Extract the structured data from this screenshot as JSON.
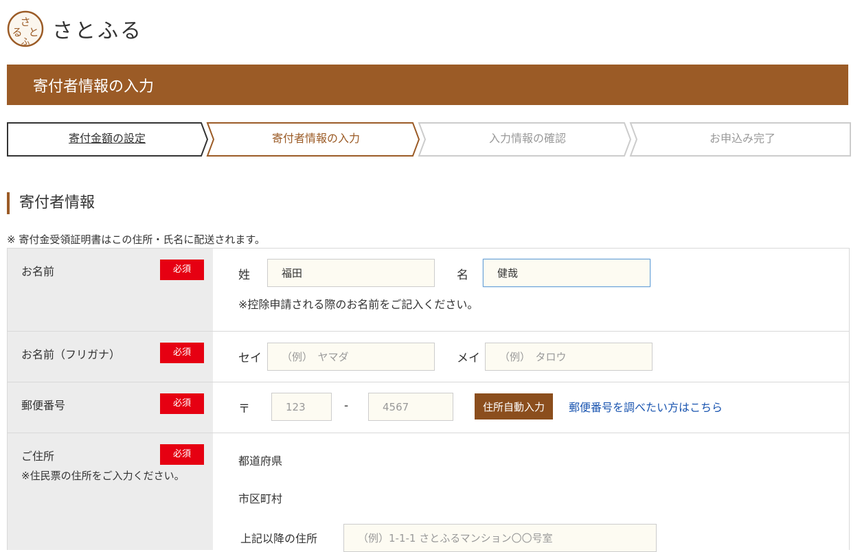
{
  "brand": {
    "name": "さとふる",
    "mark_text": "さとふる"
  },
  "page_title": "寄付者情報の入力",
  "steps": [
    {
      "label": "寄付金額の設定",
      "state": "done"
    },
    {
      "label": "寄付者情報の入力",
      "state": "current"
    },
    {
      "label": "入力情報の確認",
      "state": "upcoming"
    },
    {
      "label": "お申込み完了",
      "state": "upcoming"
    }
  ],
  "section_title": "寄付者情報",
  "note": "※ 寄付金受領証明書はこの住所・氏名に配送されます。",
  "required_label": "必須",
  "form": {
    "name": {
      "label": "お名前",
      "sei_label": "姓",
      "sei_value": "福田",
      "mei_label": "名",
      "mei_value": "健哉",
      "hint": "※控除申請される際のお名前をご記入ください。"
    },
    "kana": {
      "label": "お名前（フリガナ）",
      "sei_label": "セイ",
      "sei_placeholder": "（例）　ヤマダ",
      "mei_label": "メイ",
      "mei_placeholder": "（例）　タロウ"
    },
    "postal": {
      "label": "郵便番号",
      "prefix": "〒",
      "first_placeholder": "123",
      "separator": "-",
      "second_placeholder": "4567",
      "auto_button": "住所自動入力",
      "lookup_link": "郵便番号を調べたい方はこちら"
    },
    "address": {
      "label": "ご住所",
      "hint": "※住民票の住所をご入力ください。",
      "prefecture_label": "都道府県",
      "city_label": "市区町村",
      "street_label": "上記以降の住所",
      "street_placeholder": "（例）1-1-1 さとふるマンション〇〇号室"
    }
  },
  "colors": {
    "brand": "#9b5b26",
    "required": "#e60012",
    "link": "#1a55b0",
    "row_head_bg": "#ececec",
    "input_bg": "#fdfbf2"
  }
}
